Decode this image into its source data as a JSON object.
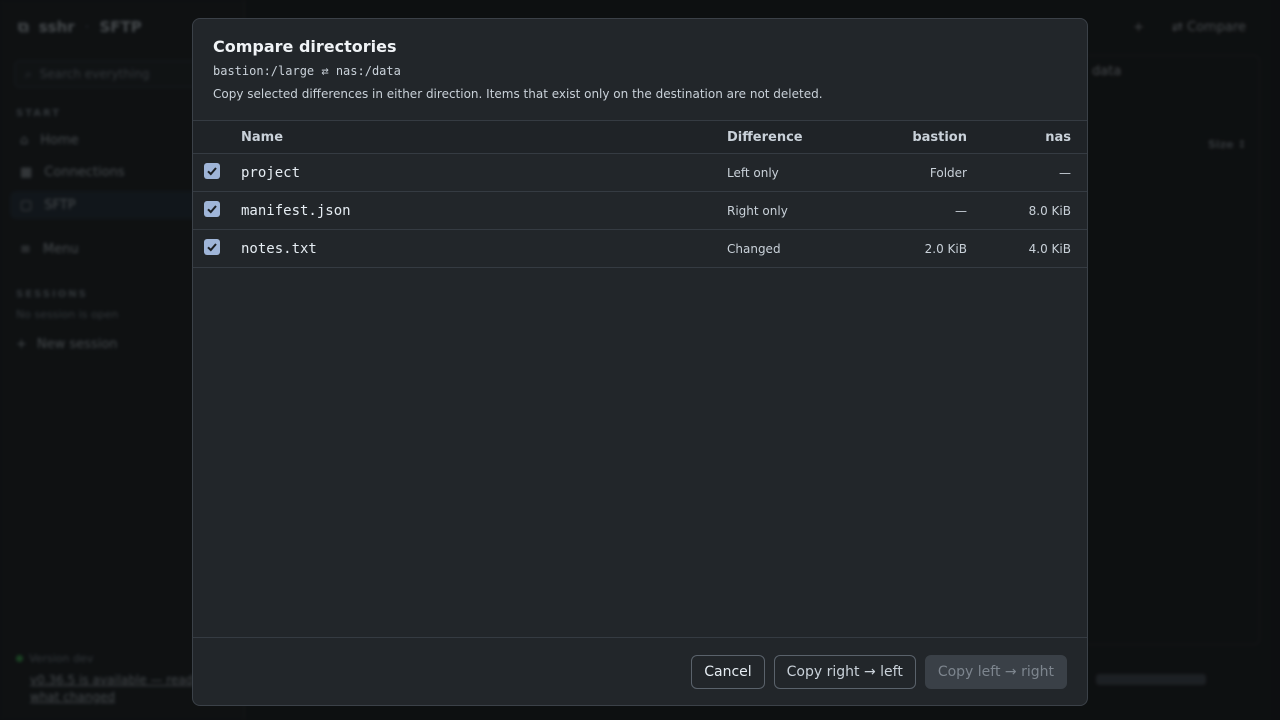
{
  "background": {
    "brand": {
      "name": "sshr",
      "section": "SFTP"
    },
    "search_placeholder": "Search everything",
    "start_label": "START",
    "nav": [
      "Home",
      "Connections",
      "SFTP",
      "Menu"
    ],
    "sessions_label": "SESSIONS",
    "no_sessions": "No session is open",
    "new_session": "New session",
    "topbar_right": [
      "+",
      "⇄ Compare"
    ],
    "panel_header": "data",
    "panel_size_header": "Size ↕",
    "update_status": "Version dev",
    "update_link": "v0.36.5 is available — read what changed"
  },
  "dialog": {
    "title": "Compare directories",
    "path": "bastion:/large ⇄ nas:/data",
    "description": "Copy selected differences in either direction. Items that exist only on the destination are not deleted.",
    "columns": {
      "name": "Name",
      "difference": "Difference",
      "left": "bastion",
      "right": "nas"
    },
    "rows": [
      {
        "checked": true,
        "name": "project",
        "difference": "Left only",
        "left": "Folder",
        "right": "—"
      },
      {
        "checked": true,
        "name": "manifest.json",
        "difference": "Right only",
        "left": "—",
        "right": "8.0 KiB"
      },
      {
        "checked": true,
        "name": "notes.txt",
        "difference": "Changed",
        "left": "2.0 KiB",
        "right": "4.0 KiB"
      }
    ],
    "buttons": {
      "cancel": "Cancel",
      "copy_right_to_left": "Copy right → left",
      "copy_left_to_right": "Copy left → right"
    }
  }
}
